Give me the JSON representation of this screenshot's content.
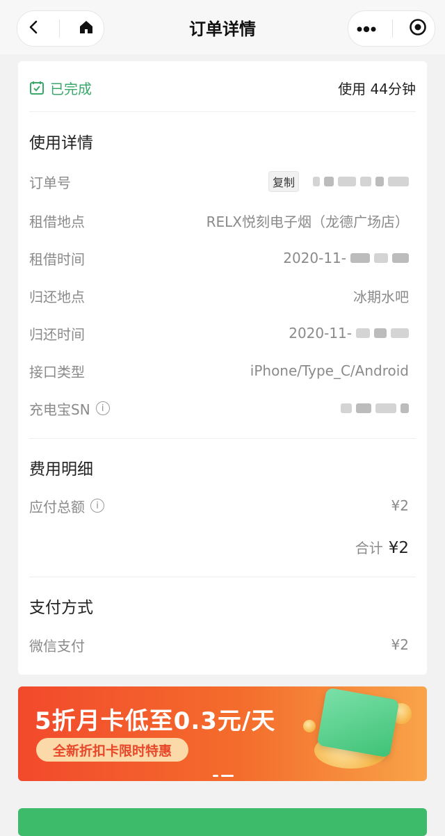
{
  "nav": {
    "title": "订单详情",
    "back_icon": "chevron-left-icon",
    "home_icon": "home-icon",
    "more_icon": "more-dots-icon",
    "close_icon": "target-close-icon"
  },
  "status": {
    "label": "已完成",
    "icon": "check-calendar-icon",
    "color": "#3aa86a",
    "duration": "使用 44分钟"
  },
  "usage": {
    "section_title": "使用详情",
    "order_no_label": "订单号",
    "copy_label": "复制",
    "rent_location_label": "租借地点",
    "rent_location": "RELX悦刻电子烟（龙德广场店）",
    "rent_time_label": "租借时间",
    "rent_time": "2020-11-",
    "return_location_label": "归还地点",
    "return_location": "冰期水吧",
    "return_time_label": "归还时间",
    "return_time": "2020-11-",
    "port_label": "接口类型",
    "port_type": "iPhone/Type_C/Android",
    "sn_label": "充电宝SN"
  },
  "fees": {
    "section_title": "费用明细",
    "payable_label": "应付总额",
    "payable_amount": "¥2",
    "total_label": "合计",
    "total_amount": "¥2"
  },
  "payment": {
    "section_title": "支付方式",
    "method": "微信支付",
    "amount": "¥2"
  },
  "banner": {
    "title": "5折月卡低至0.3元/天",
    "subtitle": "全新折扣卡限时特惠"
  },
  "colors": {
    "accent_green": "#3dbb6b",
    "banner_red": "#f2492c",
    "banner_orange": "#f8a44a"
  }
}
